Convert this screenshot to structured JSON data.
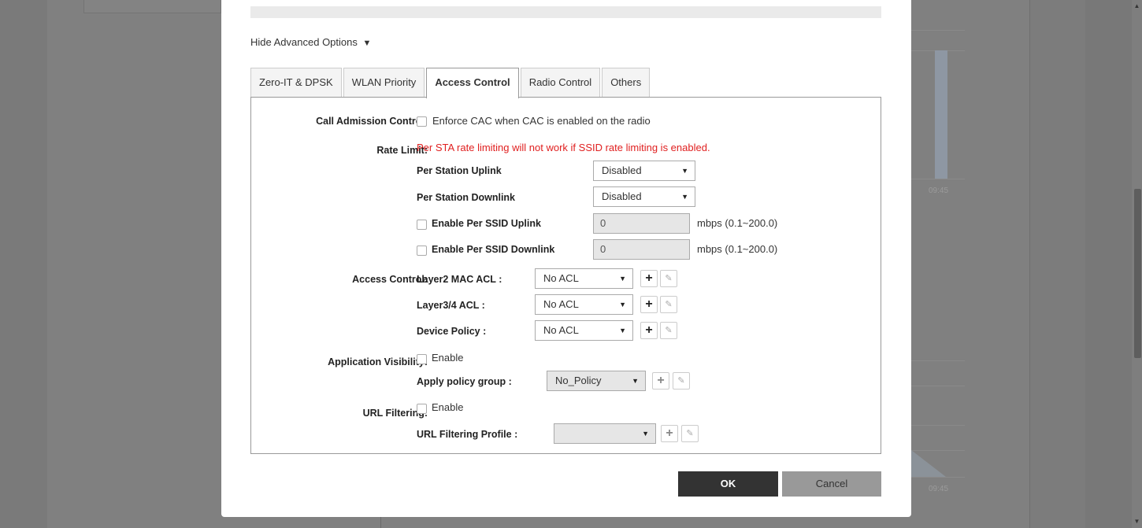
{
  "background": {
    "chart_tick_top": "09:45",
    "chart_tick_bottom": "09:45"
  },
  "advanced_toggle": {
    "label": "Hide Advanced Options",
    "caret": "▼"
  },
  "tabs": [
    {
      "label": "Zero-IT & DPSK",
      "active": false
    },
    {
      "label": "WLAN Priority",
      "active": false
    },
    {
      "label": "Access Control",
      "active": true
    },
    {
      "label": "Radio Control",
      "active": false
    },
    {
      "label": "Others",
      "active": false
    }
  ],
  "cac": {
    "label": "Call Admission Control:",
    "checkbox_label": "Enforce CAC when CAC is enabled on the radio",
    "checked": false
  },
  "rate_limit": {
    "label": "Rate Limit:",
    "warning": "Per STA rate limiting will not work if SSID rate limiting is enabled.",
    "per_station_uplink": {
      "label": "Per Station Uplink",
      "value": "Disabled"
    },
    "per_station_downlink": {
      "label": "Per Station Downlink",
      "value": "Disabled"
    },
    "per_ssid_uplink": {
      "label": "Enable Per SSID Uplink",
      "checked": false,
      "value": "0",
      "unit": "mbps (0.1~200.0)"
    },
    "per_ssid_downlink": {
      "label": "Enable Per SSID Downlink",
      "checked": false,
      "value": "0",
      "unit": "mbps (0.1~200.0)"
    }
  },
  "access_control": {
    "label": "Access Control:",
    "layer2": {
      "label": "Layer2 MAC ACL :",
      "value": "No ACL"
    },
    "layer34": {
      "label": "Layer3/4 ACL :",
      "value": "No ACL"
    },
    "device_policy": {
      "label": "Device Policy :",
      "value": "No ACL"
    }
  },
  "app_visibility": {
    "label": "Application Visibility:",
    "checkbox_label": "Enable",
    "checked": false,
    "policy_group_label": "Apply policy group :",
    "policy_group_value": "No_Policy"
  },
  "url_filtering": {
    "label": "URL Filtering:",
    "checkbox_label": "Enable",
    "checked": false,
    "profile_label": "URL Filtering Profile :",
    "profile_value": ""
  },
  "buttons": {
    "ok": "OK",
    "cancel": "Cancel"
  },
  "icons": {
    "dropdown": "▼",
    "add": "+",
    "edit": "✎",
    "scroll_up": "▲",
    "scroll_down": "▼"
  }
}
